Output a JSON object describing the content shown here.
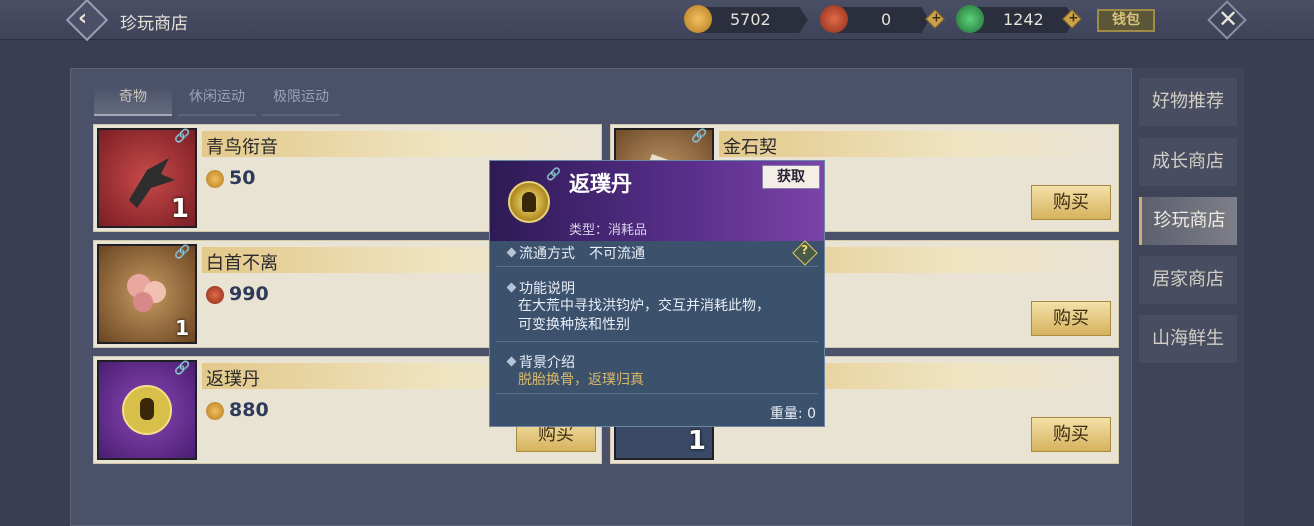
{
  "header": {
    "title": "珍玩商店",
    "currencies": [
      {
        "icon": "gold-coin-icon",
        "value": "5702",
        "color": "#c9922e"
      },
      {
        "icon": "red-token-icon",
        "value": "0",
        "color": "#b8452e"
      },
      {
        "icon": "jade-icon",
        "value": "1242",
        "color": "#2d9a4a"
      }
    ],
    "wallet_label": "钱包"
  },
  "tabs": [
    {
      "label": "奇物",
      "active": true
    },
    {
      "label": "休闲运动",
      "active": false
    },
    {
      "label": "极限运动",
      "active": false
    }
  ],
  "items": [
    {
      "name": "青鸟衔音",
      "price": "50",
      "currency": "gold-coin-icon",
      "qty": "1",
      "buy_label": ""
    },
    {
      "name": "金石契",
      "price": "",
      "currency": "",
      "qty": "",
      "buy_label": "购买"
    },
    {
      "name": "白首不离",
      "price": "990",
      "currency": "red-token-icon",
      "qty": "1",
      "buy_label": ""
    },
    {
      "name": "",
      "price": "",
      "currency": "",
      "qty": "",
      "buy_label": "购买"
    },
    {
      "name": "返璞丹",
      "price": "880",
      "currency": "gold-coin-icon",
      "qty": "",
      "buy_label": "购买"
    },
    {
      "name": "",
      "price": "",
      "currency": "",
      "qty": "1",
      "buy_label": "购买"
    }
  ],
  "side_nav": [
    {
      "label": "好物推荐",
      "active": false
    },
    {
      "label": "成长商店",
      "active": false
    },
    {
      "label": "珍玩商店",
      "active": true
    },
    {
      "label": "居家商店",
      "active": false
    },
    {
      "label": "山海鲜生",
      "active": false
    }
  ],
  "popup": {
    "title": "返璞丹",
    "get_label": "获取",
    "type_label": "类型：消耗品",
    "circulation": "流通方式　不可流通",
    "function_title": "功能说明",
    "function_line1": "在大荒中寻找洪钧炉，交互并消耗此物，",
    "function_line2": "可变换种族和性别",
    "background_title": "背景介绍",
    "background_text": "脱胎换骨，返璞归真",
    "weight": "重量: 0"
  }
}
